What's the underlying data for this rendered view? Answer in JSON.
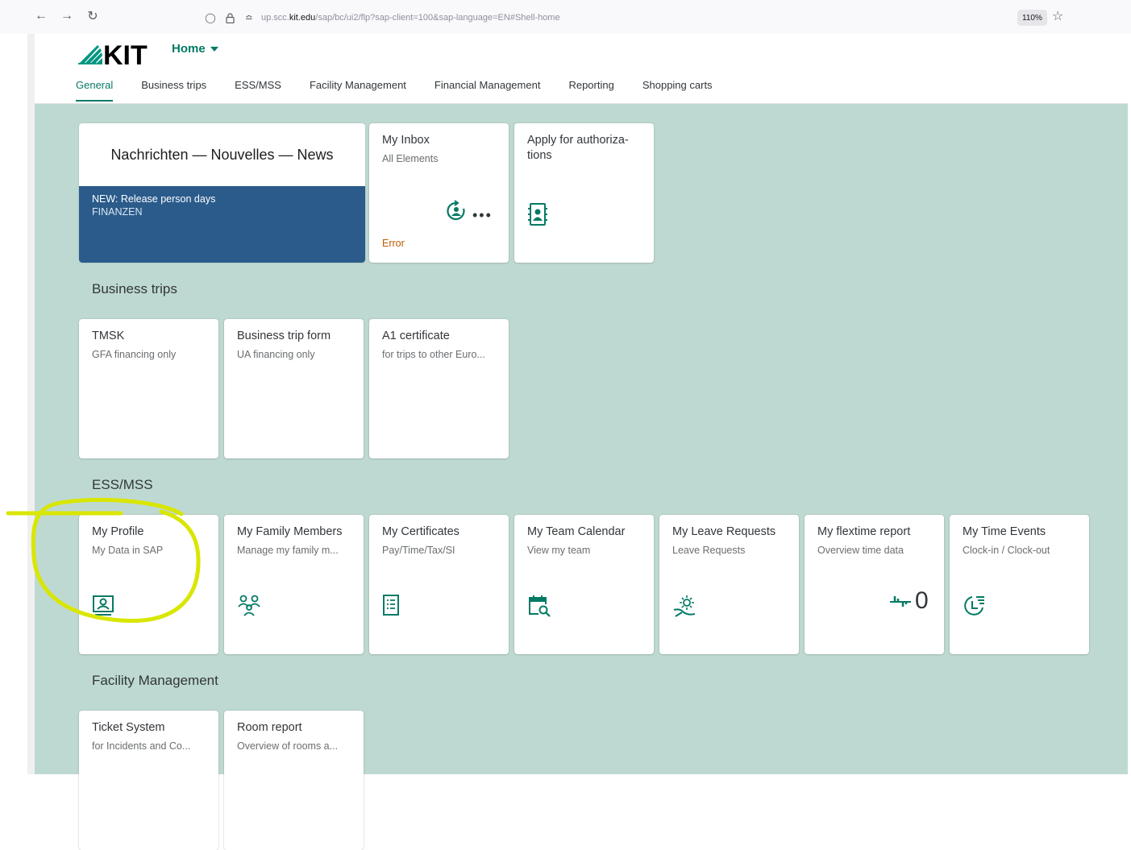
{
  "browser": {
    "url_prefix": "up.scc.",
    "url_host": "kit.edu",
    "url_path": "/sap/bc/ui2/flp?sap-client=100&sap-language=EN#Shell-home",
    "zoom": "110%"
  },
  "shell": {
    "logo_text": "KIT",
    "home_label": "Home",
    "tabs": [
      "General",
      "Business trips",
      "ESS/MSS",
      "Facility Management",
      "Financial Management",
      "Reporting",
      "Shopping carts"
    ],
    "active_tab": "General"
  },
  "general": {
    "news": {
      "header": "Nachrichten — Nouvelles — News",
      "item_title": "NEW: Release person days",
      "item_sub": "FINANZEN"
    },
    "tiles": [
      {
        "title": "My Inbox",
        "subtitle": "All Elements",
        "status": "Error",
        "icon": "inbox-refresh-icon"
      },
      {
        "title": "Apply for authoriza-tions",
        "subtitle": "",
        "icon": "address-book-icon"
      }
    ]
  },
  "sections": {
    "business_trips": {
      "title": "Business trips",
      "tiles": [
        {
          "title": "TMSK",
          "subtitle": "GFA financing only"
        },
        {
          "title": "Business trip form",
          "subtitle": "UA financing only"
        },
        {
          "title": "A1 certificate",
          "subtitle": "for trips to other Euro..."
        }
      ]
    },
    "ess_mss": {
      "title": "ESS/MSS",
      "tiles": [
        {
          "title": "My Profile",
          "subtitle": "My Data in SAP",
          "icon": "employee-icon"
        },
        {
          "title": "My Family Members",
          "subtitle": "Manage my family m...",
          "icon": "family-icon"
        },
        {
          "title": "My Certificates",
          "subtitle": "Pay/Time/Tax/SI",
          "icon": "document-list-icon"
        },
        {
          "title": "My Team Calendar",
          "subtitle": "View my team",
          "icon": "calendar-search-icon"
        },
        {
          "title": "My Leave Requests",
          "subtitle": "Leave Requests",
          "icon": "vacation-icon"
        },
        {
          "title": "My flextime report",
          "subtitle": "Overview time data",
          "icon": "time-balance-icon",
          "number": "0"
        },
        {
          "title": "My Time Events",
          "subtitle": "Clock-in / Clock-out",
          "icon": "time-entry-icon"
        }
      ]
    },
    "facility": {
      "title": "Facility Management",
      "tiles": [
        {
          "title": "Ticket System",
          "subtitle": "for Incidents and Co..."
        },
        {
          "title": "Room report",
          "subtitle": "Overview of rooms a..."
        }
      ]
    }
  },
  "colors": {
    "accent": "#047a65",
    "background": "#bed9d2",
    "news_blue": "#2a5b8b",
    "error": "#bb5a00",
    "highlight": "#d9e600"
  }
}
